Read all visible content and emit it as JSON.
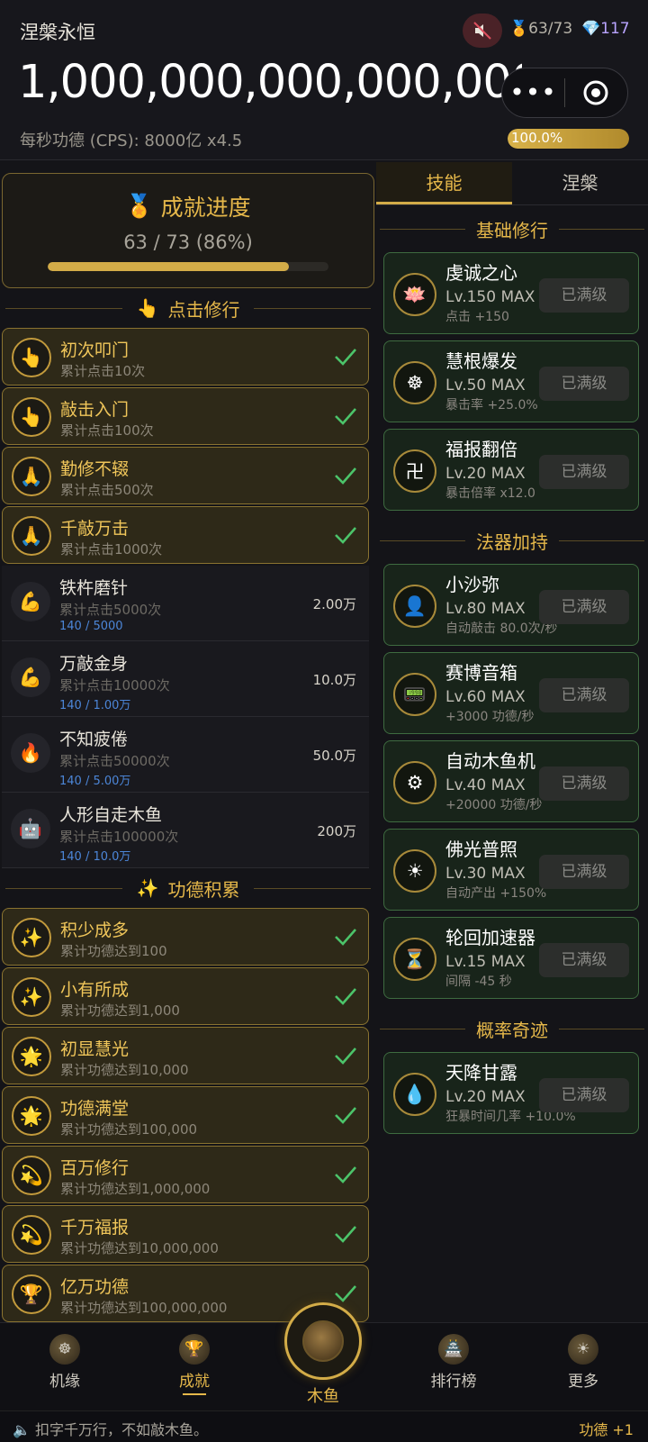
{
  "header": {
    "title": "涅槃永恒",
    "medals": "63/73",
    "gems": "117",
    "merit_total": "1,000,000,000,000,000",
    "cps": "每秒功德 (CPS): 8000亿 x4.5",
    "progress_label": "100.0%",
    "progress_value": 1.0
  },
  "achievement_progress": {
    "title": "成就进度",
    "count": "63 / 73 (86%)",
    "ratio": 0.86
  },
  "sections": {
    "click": "点击修行",
    "merit": "功德积累"
  },
  "click_achievements": [
    {
      "name": "初次叩门",
      "desc": "累计点击10次",
      "icon": "👆"
    },
    {
      "name": "敲击入门",
      "desc": "累计点击100次",
      "icon": "👆"
    },
    {
      "name": "勤修不辍",
      "desc": "累计点击500次",
      "icon": "🙏"
    },
    {
      "name": "千敲万击",
      "desc": "累计点击1000次",
      "icon": "🙏"
    }
  ],
  "locked_achievements": [
    {
      "name": "铁杵磨针",
      "desc": "累计点击5000次",
      "progress": "140 / 5000",
      "reward": "2.00万",
      "icon": "💪"
    },
    {
      "name": "万敲金身",
      "desc": "累计点击10000次",
      "progress": "140 / 1.00万",
      "reward": "10.0万",
      "icon": "💪"
    },
    {
      "name": "不知疲倦",
      "desc": "累计点击50000次",
      "progress": "140 / 5.00万",
      "reward": "50.0万",
      "icon": "🔥"
    },
    {
      "name": "人形自走木鱼",
      "desc": "累计点击100000次",
      "progress": "140 / 10.0万",
      "reward": "200万",
      "icon": "🤖"
    }
  ],
  "merit_achievements": [
    {
      "name": "积少成多",
      "desc": "累计功德达到100",
      "icon": "✨"
    },
    {
      "name": "小有所成",
      "desc": "累计功德达到1,000",
      "icon": "✨"
    },
    {
      "name": "初显慧光",
      "desc": "累计功德达到10,000",
      "icon": "🌟"
    },
    {
      "name": "功德满堂",
      "desc": "累计功德达到100,000",
      "icon": "🌟"
    },
    {
      "name": "百万修行",
      "desc": "累计功德达到1,000,000",
      "icon": "💫"
    },
    {
      "name": "千万福报",
      "desc": "累计功德达到10,000,000",
      "icon": "💫"
    },
    {
      "name": "亿万功德",
      "desc": "累计功德达到100,000,000",
      "icon": "🏆"
    }
  ],
  "tabs": [
    "技能",
    "涅槃"
  ],
  "skill_sections": [
    "基础修行",
    "法器加持",
    "概率奇迹"
  ],
  "skills_basic": [
    {
      "name": "虔诚之心",
      "level": "Lv.150 MAX",
      "effect": "点击 +150",
      "button": "已满级",
      "icon": "🪷"
    },
    {
      "name": "慧根爆发",
      "level": "Lv.50 MAX",
      "effect": "暴击率 +25.0%",
      "button": "已满级",
      "icon": "☸"
    },
    {
      "name": "福报翻倍",
      "level": "Lv.20 MAX",
      "effect": "暴击倍率 x12.0",
      "button": "已满级",
      "icon": "卍"
    }
  ],
  "skills_tools": [
    {
      "name": "小沙弥",
      "level": "Lv.80 MAX",
      "effect": "自动敲击 80.0次/秒",
      "button": "已满级",
      "icon": "👤"
    },
    {
      "name": "赛博音箱",
      "level": "Lv.60 MAX",
      "effect": "+3000 功德/秒",
      "button": "已满级",
      "icon": "📟"
    },
    {
      "name": "自动木鱼机",
      "level": "Lv.40 MAX",
      "effect": "+20000 功德/秒",
      "button": "已满级",
      "icon": "⚙"
    },
    {
      "name": "佛光普照",
      "level": "Lv.30 MAX",
      "effect": "自动产出 +150%",
      "button": "已满级",
      "icon": "☀"
    },
    {
      "name": "轮回加速器",
      "level": "Lv.15 MAX",
      "effect": "间隔 -45 秒",
      "button": "已满级",
      "icon": "⏳"
    }
  ],
  "skills_luck": [
    {
      "name": "天降甘露",
      "level": "Lv.20 MAX",
      "effect": "狂暴时间几率 +10.0%",
      "button": "已满级",
      "icon": "💧"
    }
  ],
  "nav": [
    {
      "label": "机缘"
    },
    {
      "label": "成就"
    },
    {
      "label": "木鱼"
    },
    {
      "label": "排行榜"
    },
    {
      "label": "更多"
    }
  ],
  "footer": {
    "message": "扣字千万行，不如敲木鱼。",
    "merit_gain": "功德 +1"
  },
  "colors": {
    "accent": "#e6b84a",
    "check": "#4cc46a"
  }
}
